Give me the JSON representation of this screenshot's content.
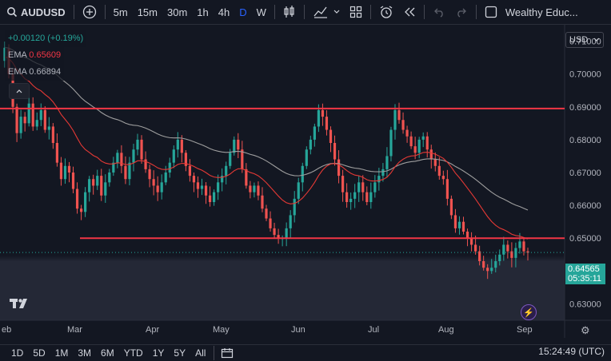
{
  "toolbar": {
    "symbol": "AUDUSD",
    "intervals": [
      "5m",
      "15m",
      "30m",
      "1h",
      "4h",
      "D",
      "W"
    ],
    "active_interval": "D",
    "account_label": "Wealthy Educ..."
  },
  "legend": {
    "change": "+0.00120 (+0.19%)",
    "ema1_label": "EMA",
    "ema1_value": "0.65609",
    "ema2_label": "EMA",
    "ema2_value": "0.66894"
  },
  "currency_selector": "USD",
  "price_axis": [
    "0.71000",
    "0.70000",
    "0.69000",
    "0.68000",
    "0.67000",
    "0.66000",
    "0.65000",
    "0.64000",
    "0.63000"
  ],
  "time_axis": [
    "eb",
    "Mar",
    "Apr",
    "May",
    "Jun",
    "Jul",
    "Aug",
    "Sep"
  ],
  "current_price": {
    "price": "0.64565",
    "countdown": "05:35:11"
  },
  "bottom": {
    "ranges": [
      "1D",
      "5D",
      "1M",
      "3M",
      "6M",
      "YTD",
      "1Y",
      "5Y",
      "All"
    ],
    "clock": "15:24:49 (UTC)"
  },
  "chart_data": {
    "type": "candlestick",
    "y_range": [
      0.625,
      0.715
    ],
    "resistance": 0.6895,
    "support": 0.65,
    "current": 0.64565,
    "closes": [
      0.708,
      0.7,
      0.69,
      0.682,
      0.687,
      0.685,
      0.691,
      0.684,
      0.686,
      0.689,
      0.683,
      0.684,
      0.679,
      0.673,
      0.668,
      0.672,
      0.67,
      0.665,
      0.659,
      0.658,
      0.664,
      0.668,
      0.666,
      0.669,
      0.663,
      0.667,
      0.67,
      0.673,
      0.676,
      0.672,
      0.668,
      0.673,
      0.677,
      0.68,
      0.674,
      0.671,
      0.668,
      0.666,
      0.664,
      0.667,
      0.67,
      0.673,
      0.677,
      0.68,
      0.676,
      0.672,
      0.669,
      0.667,
      0.665,
      0.666,
      0.663,
      0.661,
      0.664,
      0.667,
      0.669,
      0.672,
      0.676,
      0.68,
      0.677,
      0.671,
      0.666,
      0.664,
      0.666,
      0.663,
      0.659,
      0.656,
      0.653,
      0.651,
      0.65,
      0.65,
      0.653,
      0.657,
      0.662,
      0.667,
      0.672,
      0.677,
      0.68,
      0.684,
      0.689,
      0.687,
      0.683,
      0.679,
      0.674,
      0.669,
      0.664,
      0.661,
      0.662,
      0.664,
      0.667,
      0.664,
      0.661,
      0.664,
      0.667,
      0.669,
      0.671,
      0.675,
      0.683,
      0.689,
      0.686,
      0.683,
      0.681,
      0.678,
      0.676,
      0.68,
      0.681,
      0.677,
      0.674,
      0.672,
      0.669,
      0.668,
      0.662,
      0.657,
      0.653,
      0.655,
      0.652,
      0.65,
      0.648,
      0.646,
      0.643,
      0.641,
      0.64,
      0.641,
      0.643,
      0.645,
      0.648,
      0.646,
      0.644,
      0.647,
      0.649,
      0.646,
      0.6456
    ]
  }
}
